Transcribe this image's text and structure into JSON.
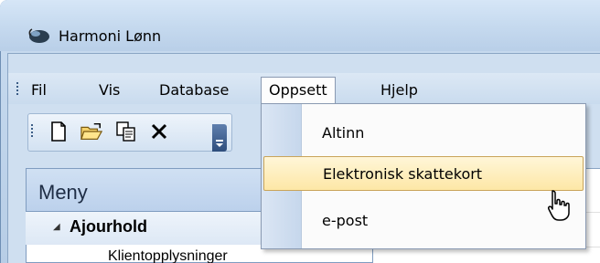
{
  "window": {
    "title": "Harmoni Lønn",
    "icon": "app-mouse-icon"
  },
  "menubar": {
    "items": [
      {
        "label": "Fil"
      },
      {
        "label": "Vis"
      },
      {
        "label": "Database"
      },
      {
        "label": "Oppsett",
        "open": true
      },
      {
        "label": "Hjelp"
      }
    ]
  },
  "toolbar": {
    "buttons": [
      {
        "icon": "new-document-icon"
      },
      {
        "icon": "open-folder-icon"
      },
      {
        "icon": "copy-icon"
      },
      {
        "icon": "delete-x-icon"
      },
      {
        "icon": "overflow-chevron-icon"
      }
    ]
  },
  "panel": {
    "title": "Meny",
    "section": {
      "label": "Ajourhold",
      "expanded": true
    },
    "items": [
      {
        "label": "Klientopplysninger"
      }
    ]
  },
  "dropdown": {
    "items": [
      {
        "label": "Altinn"
      },
      {
        "label": "Elektronisk skattekort",
        "hovered": true
      },
      {
        "label": "e-post"
      }
    ]
  },
  "colors": {
    "hover_fill": "#fde7a6",
    "hover_border": "#c9a45a",
    "titlebar": "#c6daef"
  }
}
